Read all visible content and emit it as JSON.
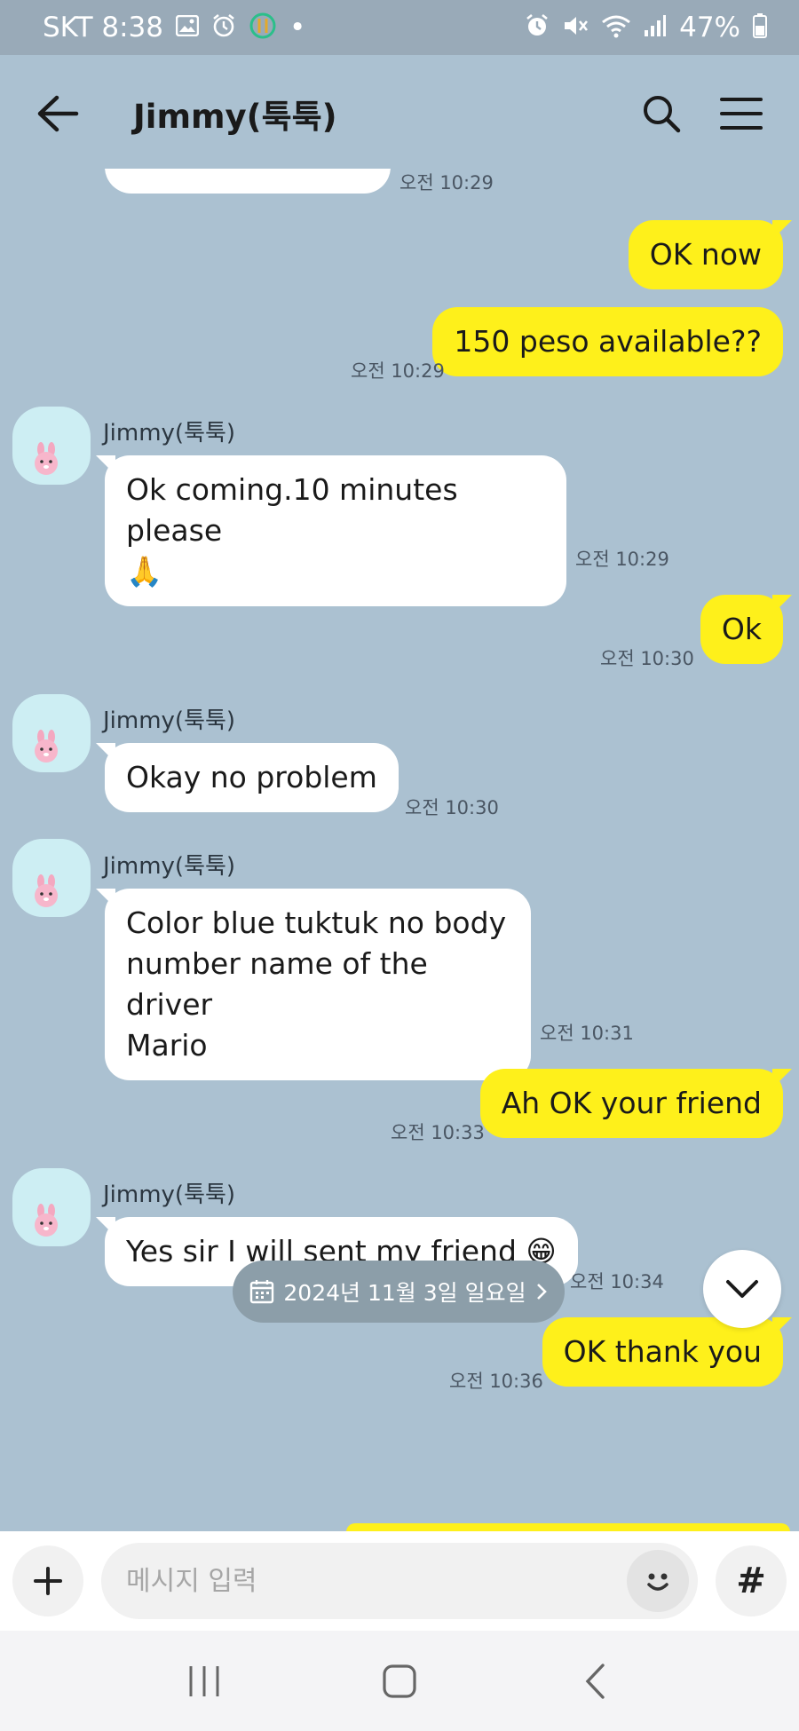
{
  "status_bar": {
    "carrier_time": "SKT 8:38",
    "dot": "•",
    "battery": "47%"
  },
  "header": {
    "title": "Jimmy(툭툭)"
  },
  "messages": [
    {
      "side": "them",
      "partial": true,
      "time": "오전 10:29"
    },
    {
      "side": "me",
      "text": "OK now"
    },
    {
      "side": "me",
      "text": "150 peso available??",
      "time": "오전 10:29"
    },
    {
      "side": "them",
      "sender": "Jimmy(툭툭)",
      "lines": [
        "Ok coming.10 minutes please",
        "🙏"
      ],
      "time": "오전 10:29"
    },
    {
      "side": "me",
      "text": "Ok",
      "time": "오전 10:30"
    },
    {
      "side": "them",
      "sender": "Jimmy(툭툭)",
      "text": "Okay no problem",
      "time": "오전 10:30"
    },
    {
      "side": "them",
      "sender": "Jimmy(툭툭)",
      "lines": [
        "Color blue tuktuk no body",
        "number name of the driver",
        "Mario"
      ],
      "time": "오전 10:31"
    },
    {
      "side": "me",
      "text": "Ah OK your friend",
      "time": "오전 10:33"
    },
    {
      "side": "them",
      "sender": "Jimmy(툭툭)",
      "text": "Yes sir I will sent my friend 😁",
      "time": "오전 10:34"
    },
    {
      "side": "me",
      "text": "OK thank you",
      "time": "오전 10:36"
    }
  ],
  "date_divider": {
    "label": "2024년 11월 3일 일요일"
  },
  "input": {
    "placeholder": "메시지 입력",
    "value": ""
  },
  "icons": {
    "back": "arrow-left-icon",
    "search": "search-icon",
    "menu": "hamburger-menu-icon",
    "plus": "plus-icon",
    "emoji": "emoji-icon",
    "hash": "#",
    "scroll_down": "chevron-down-icon",
    "calendar": "calendar-icon",
    "chevron_right": "chevron-right-icon"
  },
  "colors": {
    "background": "#abc1d1",
    "my_bubble": "#fef01b",
    "their_bubble": "#ffffff"
  }
}
